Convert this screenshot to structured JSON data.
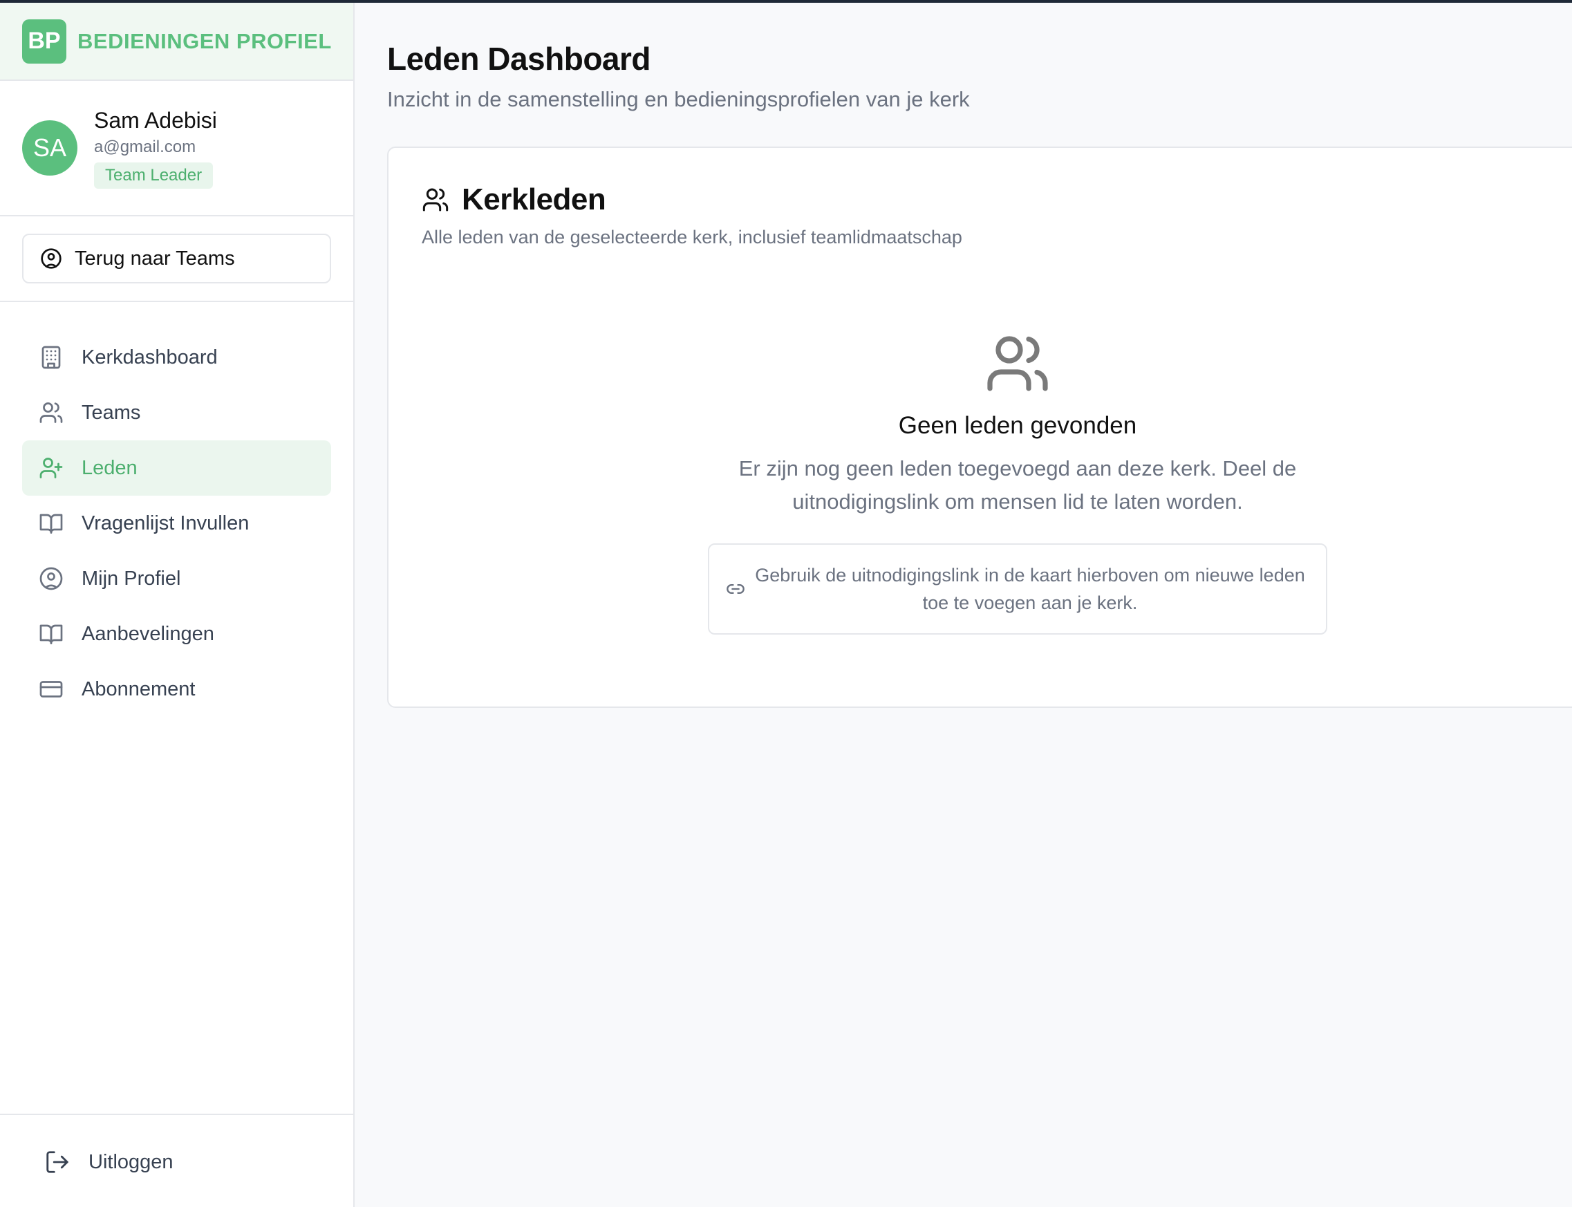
{
  "brand": {
    "logo": "BP",
    "name": "BEDIENINGEN PROFIEL"
  },
  "user": {
    "initials": "SA",
    "name": "Sam Adebisi",
    "email": "a@gmail.com",
    "role": "Team Leader"
  },
  "back_button": {
    "label": "Terug naar Teams",
    "icon": "user-circle-icon"
  },
  "nav": {
    "items": [
      {
        "label": "Kerkdashboard",
        "icon": "building-icon"
      },
      {
        "label": "Teams",
        "icon": "users-icon"
      },
      {
        "label": "Leden",
        "icon": "user-plus-icon",
        "active": true
      },
      {
        "label": "Vragenlijst Invullen",
        "icon": "book-icon"
      },
      {
        "label": "Mijn Profiel",
        "icon": "user-circle-icon"
      },
      {
        "label": "Aanbevelingen",
        "icon": "book-icon"
      },
      {
        "label": "Abonnement",
        "icon": "credit-card-icon"
      }
    ]
  },
  "logout": {
    "label": "Uitloggen",
    "icon": "logout-icon"
  },
  "page": {
    "title": "Leden Dashboard",
    "subtitle": "Inzicht in de samenstelling en bedieningsprofielen van je kerk"
  },
  "card": {
    "title": "Kerkleden",
    "subtitle": "Alle leden van de geselecteerde kerk, inclusief teamlidmaatschap",
    "empty_title": "Geen leden gevonden",
    "empty_text": "Er zijn nog geen leden toegevoegd aan deze kerk. Deel de uitnodigingslink om mensen lid te laten worden.",
    "hint": "Gebruik de uitnodigingslink in de kaart hierboven om nieuwe leden toe te voegen aan je kerk."
  },
  "colors": {
    "accent": "#5bbf7e",
    "active_bg": "#ebf6ee",
    "text_muted": "#6b7280"
  }
}
